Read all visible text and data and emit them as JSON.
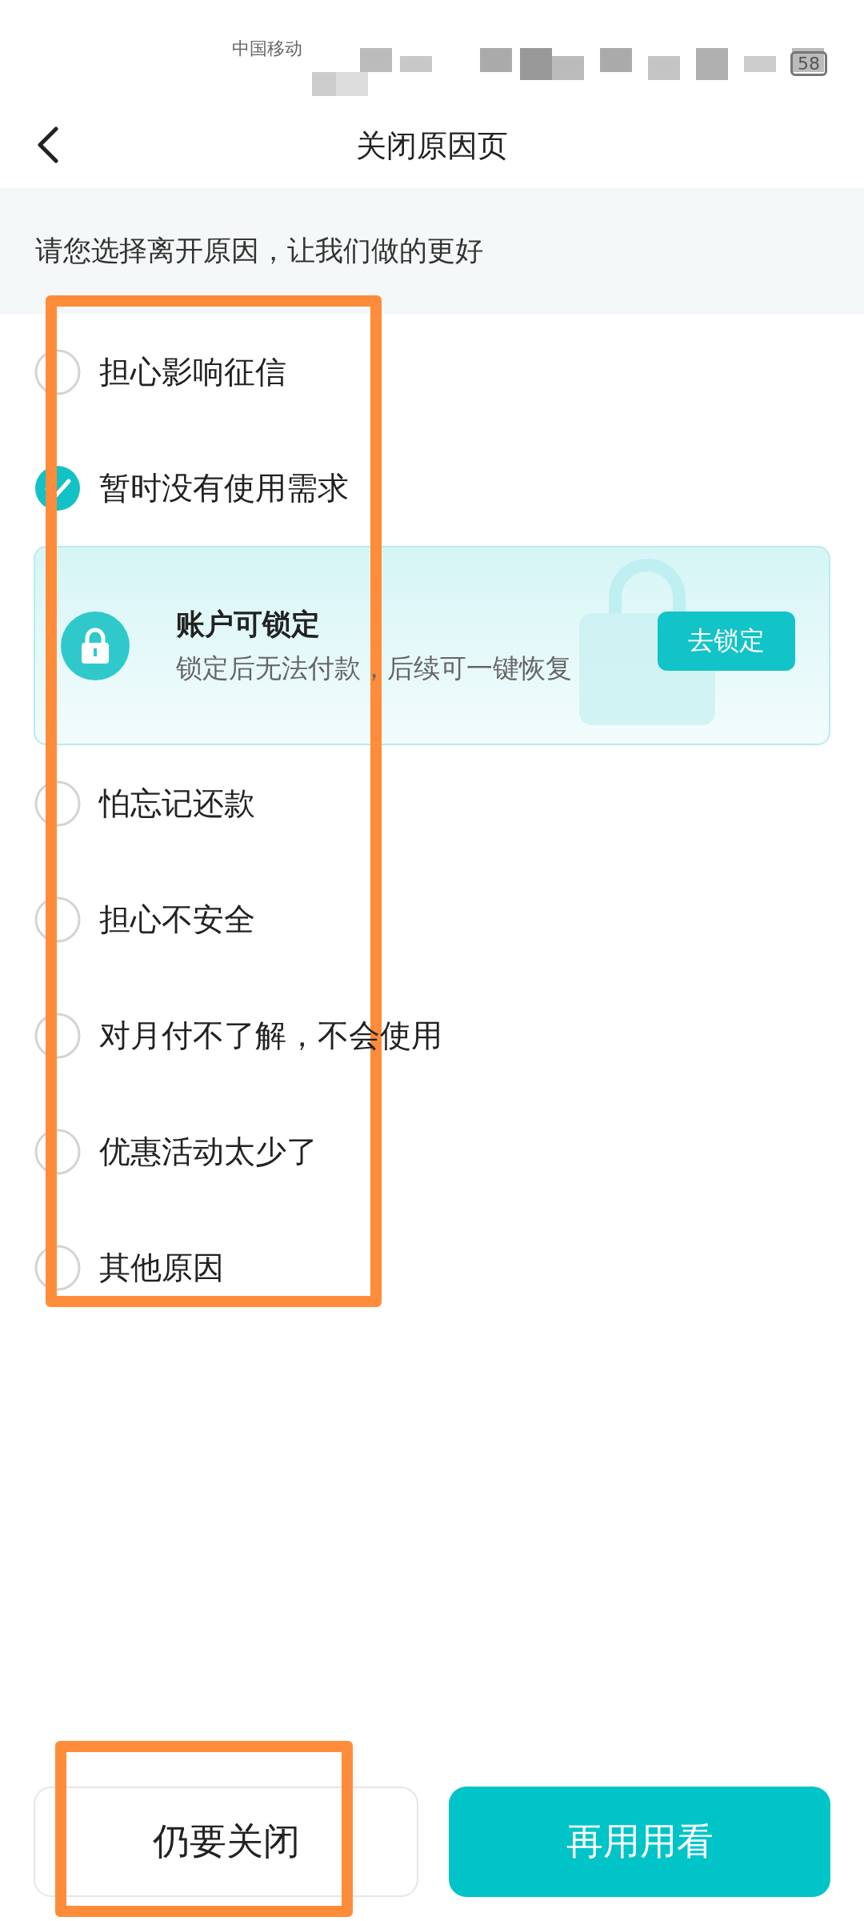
{
  "status_bar": {
    "carrier": "中国移动",
    "battery": "58"
  },
  "nav": {
    "title": "关闭原因页"
  },
  "banner": {
    "text": "请您选择离开原因，让我们做的更好"
  },
  "items": [
    {
      "kind": "option",
      "label": "担心影响征信",
      "selected": false
    },
    {
      "kind": "option",
      "label": "暂时没有使用需求",
      "selected": true
    },
    {
      "kind": "promo",
      "title": "账户可锁定",
      "subtitle": "锁定后无法付款，后续可一键恢复",
      "button": "去锁定"
    },
    {
      "kind": "option",
      "label": "怕忘记还款",
      "selected": false
    },
    {
      "kind": "option",
      "label": "担心不安全",
      "selected": false
    },
    {
      "kind": "option",
      "label": "对月付不了解，不会使用",
      "selected": false
    },
    {
      "kind": "option",
      "label": "优惠活动太少了",
      "selected": false
    },
    {
      "kind": "option",
      "label": "其他原因",
      "selected": false
    }
  ],
  "buttons": [
    {
      "kind": "secondary",
      "label": "仍要关闭"
    },
    {
      "kind": "primary",
      "label": "再用用看"
    }
  ],
  "highlights": {
    "options": true,
    "buttons": true
  }
}
